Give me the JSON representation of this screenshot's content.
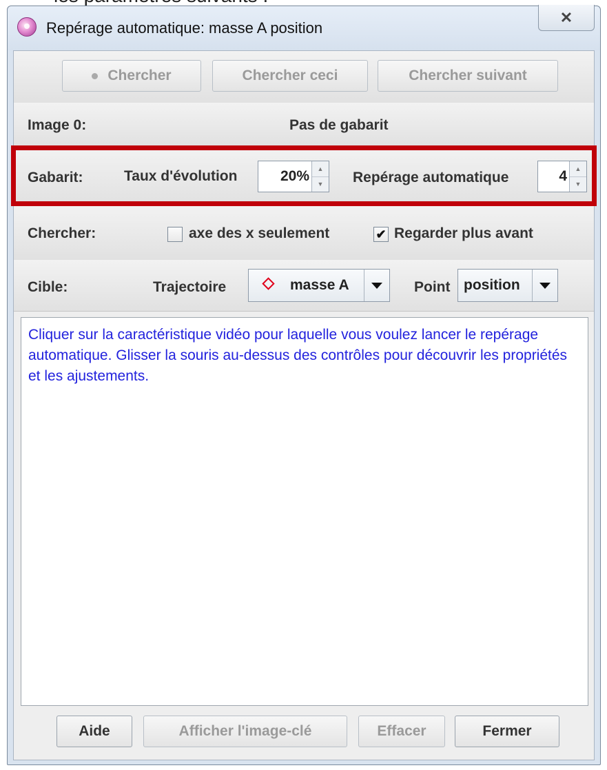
{
  "background": {
    "caption": "les paramètres suivants :"
  },
  "window": {
    "title": "Repérage automatique: masse A position",
    "close_glyph": "✕"
  },
  "toolbar": {
    "search": "Chercher",
    "search_this": "Chercher ceci",
    "search_next": "Chercher suivant"
  },
  "image_row": {
    "label": "Image 0:",
    "status": "Pas de gabarit"
  },
  "template_row": {
    "label": "Gabarit:",
    "evolution_label": "Taux d'évolution",
    "evolution_value": "20%",
    "autotrack_label": "Repérage automatique",
    "autotrack_value": "4"
  },
  "search_row": {
    "label": "Chercher:",
    "x_axis_only": "axe des x seulement",
    "x_axis_only_checked": false,
    "look_ahead": "Regarder plus avant",
    "look_ahead_checked": true,
    "check_glyph": "✔"
  },
  "target_row": {
    "label": "Cible:",
    "track_label": "Trajectoire",
    "track_value": "masse A",
    "track_icon": "red-diamond-icon",
    "point_label": "Point",
    "point_value": "position"
  },
  "message": "Cliquer sur la caractéristique vidéo pour laquelle vous voulez lancer le repérage automatique. Glisser la souris au-dessus des contrôles pour découvrir les propriétés et les ajustements.",
  "footer": {
    "help": "Aide",
    "show_keyframe": "Afficher l'image-clé",
    "clear": "Effacer",
    "close": "Fermer"
  },
  "colors": {
    "highlight": "#c0000a",
    "message_text": "#2222dd",
    "track_marker": "#e0001a"
  }
}
